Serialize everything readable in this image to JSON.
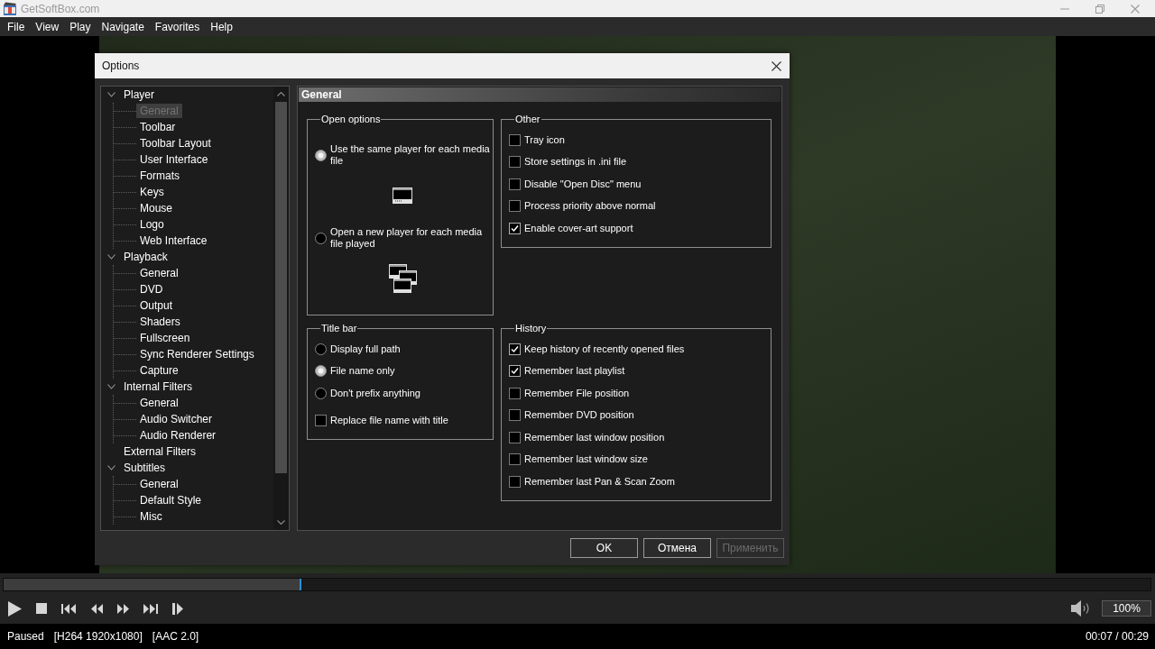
{
  "window": {
    "title": "GetSoftBox.com"
  },
  "menu": [
    "File",
    "View",
    "Play",
    "Navigate",
    "Favorites",
    "Help"
  ],
  "options_dialog": {
    "title": "Options",
    "tree": [
      {
        "label": "Player",
        "selected": false,
        "expanded": true,
        "children": [
          {
            "label": "General",
            "selected": true
          },
          {
            "label": "Toolbar",
            "selected": false
          },
          {
            "label": "Toolbar Layout",
            "selected": false
          },
          {
            "label": "User Interface",
            "selected": false
          },
          {
            "label": "Formats",
            "selected": false
          },
          {
            "label": "Keys",
            "selected": false
          },
          {
            "label": "Mouse",
            "selected": false
          },
          {
            "label": "Logo",
            "selected": false
          },
          {
            "label": "Web Interface",
            "selected": false
          }
        ]
      },
      {
        "label": "Playback",
        "selected": false,
        "expanded": true,
        "children": [
          {
            "label": "General",
            "selected": false
          },
          {
            "label": "DVD",
            "selected": false
          },
          {
            "label": "Output",
            "selected": false
          },
          {
            "label": "Shaders",
            "selected": false
          },
          {
            "label": "Fullscreen",
            "selected": false
          },
          {
            "label": "Sync Renderer Settings",
            "selected": false
          },
          {
            "label": "Capture",
            "selected": false
          }
        ]
      },
      {
        "label": "Internal Filters",
        "selected": false,
        "expanded": true,
        "children": [
          {
            "label": "General",
            "selected": false
          },
          {
            "label": "Audio Switcher",
            "selected": false
          },
          {
            "label": "Audio Renderer",
            "selected": false
          }
        ]
      },
      {
        "label": "External Filters",
        "selected": false
      },
      {
        "label": "Subtitles",
        "selected": false,
        "expanded": true,
        "children": [
          {
            "label": "General",
            "selected": false
          },
          {
            "label": "Default Style",
            "selected": false
          },
          {
            "label": "Misc",
            "selected": false
          }
        ]
      }
    ],
    "page": {
      "title": "General",
      "groups": [
        {
          "title": "Open options",
          "items": [
            {
              "kind": "single",
              "label": "Use the same player for each media file",
              "selected": true
            },
            {
              "kind": "multiple",
              "label": "Open a new player for each media file played",
              "selected": false
            }
          ]
        },
        {
          "title": "Other",
          "items": [
            {
              "kind": "checkbox",
              "label": "Tray icon",
              "checked": false
            },
            {
              "kind": "checkbox",
              "label": "Store settings in .ini file",
              "checked": false
            },
            {
              "kind": "checkbox",
              "label": "Disable \"Open Disc\" menu",
              "checked": false
            },
            {
              "kind": "checkbox",
              "label": "Process priority above normal",
              "checked": false
            },
            {
              "kind": "checkbox",
              "label": "Enable cover-art support",
              "checked": true
            }
          ]
        },
        {
          "title": "Title bar",
          "items": [
            {
              "kind": "radio",
              "label": "Display full path",
              "selected": false
            },
            {
              "kind": "radio",
              "label": "File name only",
              "selected": true
            },
            {
              "kind": "radio",
              "label": "Don't prefix anything",
              "selected": false
            },
            {
              "kind": "checkbox",
              "label": "Replace file name with title",
              "checked": false
            }
          ]
        },
        {
          "title": "History",
          "items": [
            {
              "kind": "checkbox",
              "label": "Keep history of recently opened files",
              "checked": true
            },
            {
              "kind": "checkbox",
              "label": "Remember last playlist",
              "checked": true
            },
            {
              "kind": "checkbox",
              "label": "Remember File position",
              "checked": false
            },
            {
              "kind": "checkbox",
              "label": "Remember DVD position",
              "checked": false
            },
            {
              "kind": "checkbox",
              "label": "Remember last window position",
              "checked": false
            },
            {
              "kind": "checkbox",
              "label": "Remember last window size",
              "checked": false
            },
            {
              "kind": "checkbox",
              "label": "Remember last Pan & Scan Zoom",
              "checked": false
            }
          ]
        }
      ]
    },
    "buttons": [
      {
        "label": "OK",
        "disabled": false
      },
      {
        "label": "Отмена",
        "disabled": false
      },
      {
        "label": "Применить",
        "disabled": true
      }
    ]
  },
  "seek_bar": {
    "level": 0.26
  },
  "volume": {
    "reading": "100%"
  },
  "status_bar": {
    "state": "Paused",
    "video": "[H264 1920x1080]",
    "audio": "[AAC 2.0]",
    "time": "00:07 / 00:29"
  }
}
